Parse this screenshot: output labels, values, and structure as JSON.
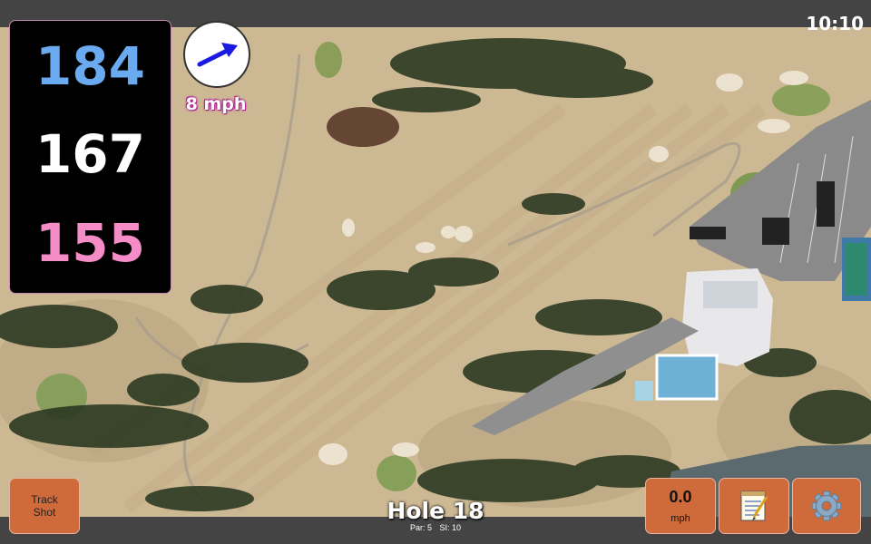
{
  "status": {
    "clock": "10:10"
  },
  "distances": {
    "back": "184",
    "center": "167",
    "front": "155"
  },
  "wind": {
    "speed_label": "8 mph",
    "direction_icon": "arrow-right-up-icon"
  },
  "hole": {
    "title": "Hole 18",
    "par": "Par: 5",
    "stroke_index": "SI: 10"
  },
  "buttons": {
    "track_line1": "Track",
    "track_line2": "Shot",
    "speed_value": "0.0",
    "speed_unit": "mph",
    "notes_icon": "notepad-icon",
    "settings_icon": "gear-icon"
  },
  "colors": {
    "back": "#6aaaf0",
    "center": "#ffffff",
    "front": "#f48cc8",
    "button": "#cf6a3a",
    "wind_arrow": "#1a1ae0"
  }
}
